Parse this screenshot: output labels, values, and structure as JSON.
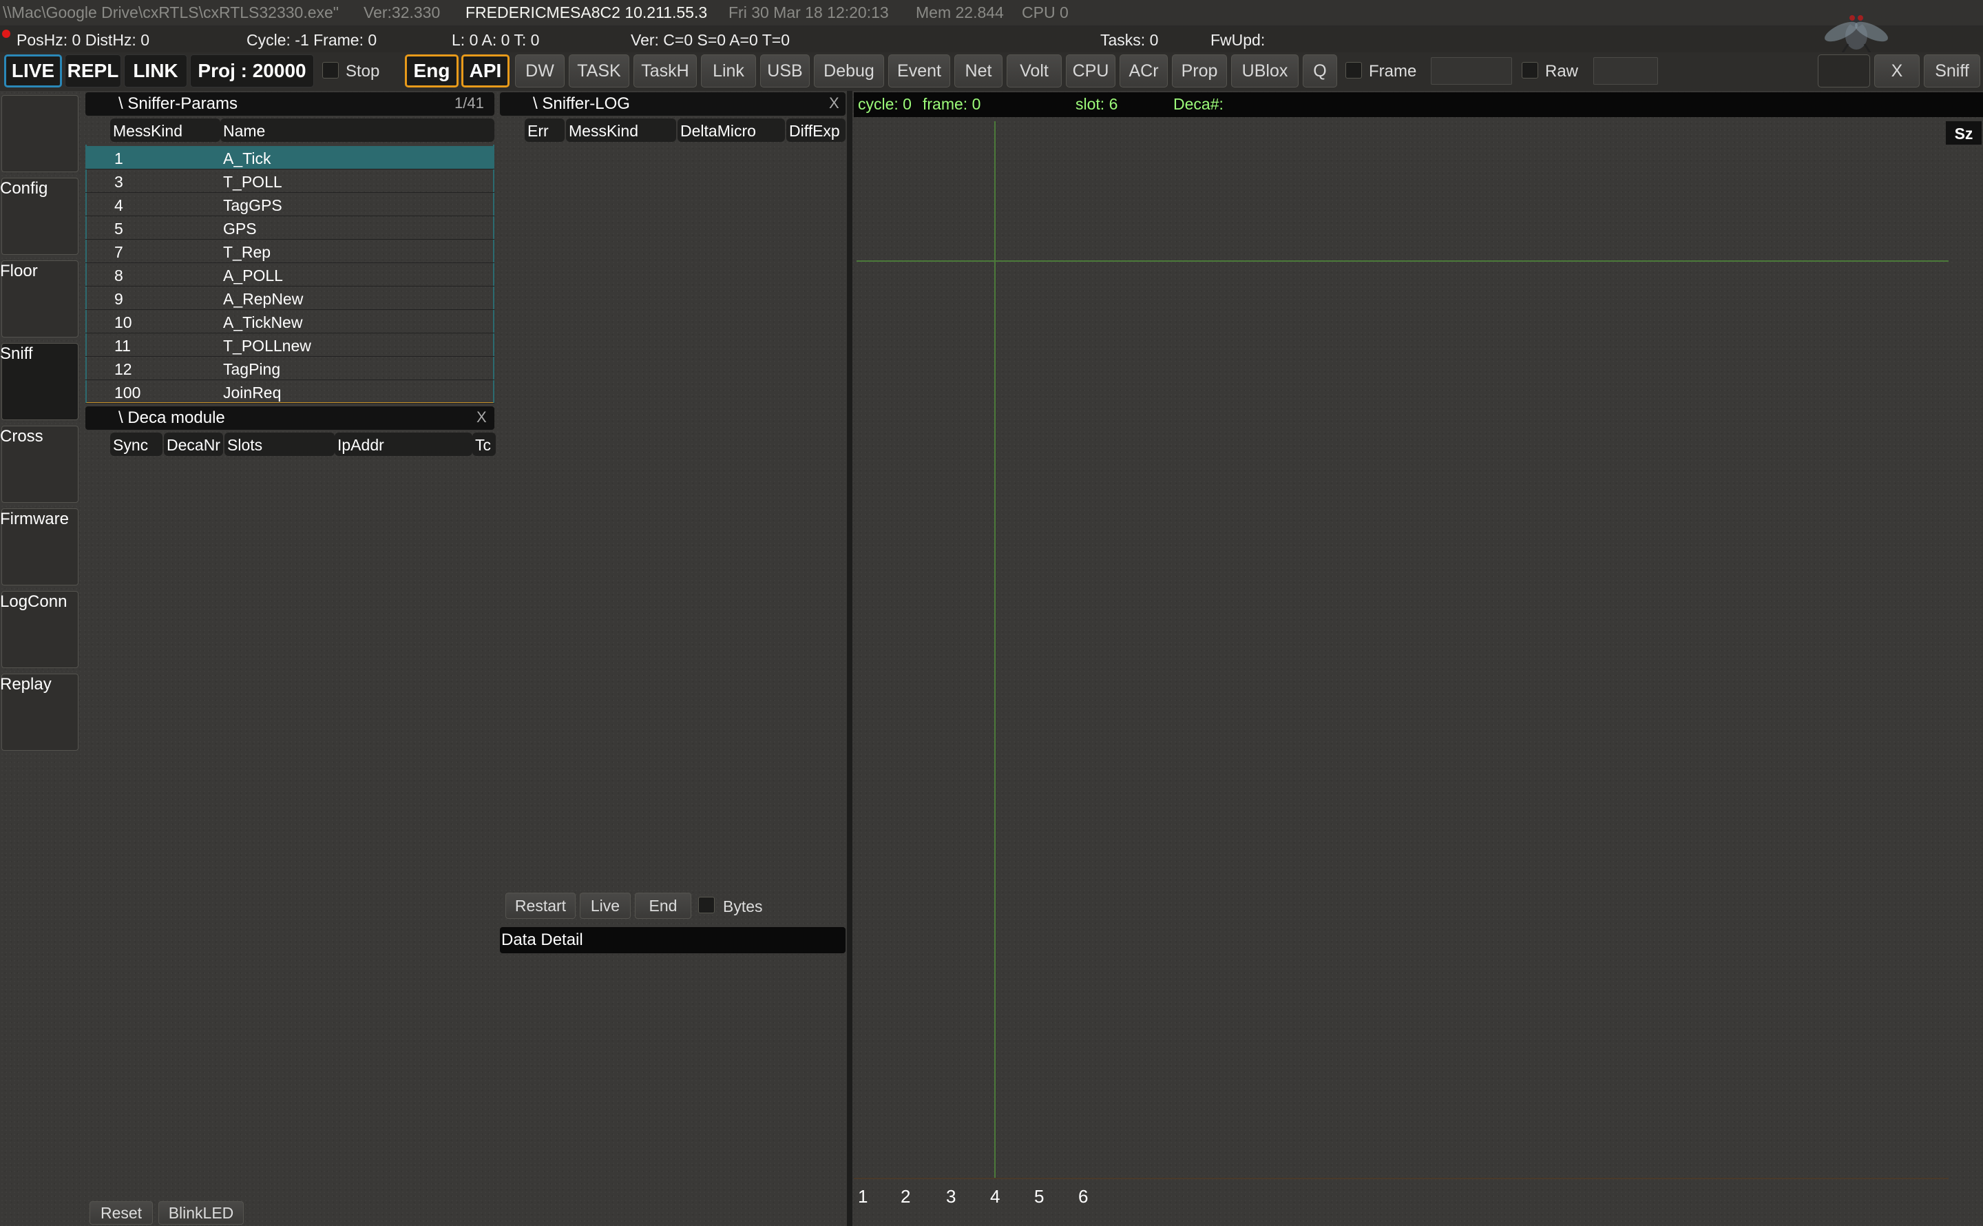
{
  "titlebar": {
    "path": "\\\\Mac\\Google Drive\\cxRTLS\\cxRTLS32330.exe\"",
    "version": "Ver:32.330",
    "host": "FREDERICMESA8C2 10.211.55.3",
    "datetime": "Fri 30 Mar 18 12:20:13",
    "mem": "Mem 22.844",
    "cpu": "CPU 0"
  },
  "status": {
    "poshz": "PosHz: 0 DistHz: 0",
    "cycle": "Cycle: -1  Frame: 0",
    "lat": "L: 0  A: 0  T: 0",
    "ver": "Ver: C=0 S=0 A=0 T=0",
    "tasks": "Tasks: 0",
    "fwupd": "FwUpd:"
  },
  "toolbar": {
    "live": "LIVE",
    "repl": "REPL",
    "link_mode": "LINK",
    "proj": "Proj : 20000",
    "stop": "Stop",
    "eng": "Eng",
    "api": "API",
    "buttons": [
      "DW",
      "TASK",
      "TaskH",
      "Link",
      "USB",
      "Debug",
      "Event",
      "Net",
      "Volt",
      "CPU",
      "ACr",
      "Prop",
      "UBlox",
      "Q"
    ],
    "frame": "Frame",
    "raw": "Raw",
    "close": "X",
    "sniff": "Sniff"
  },
  "nav": [
    "Config",
    "Floor",
    "Sniff",
    "Cross",
    "Firmware",
    "LogConn",
    "Replay"
  ],
  "sniffer_params": {
    "title": "\\ Sniffer-Params",
    "count": "1/41",
    "columns": [
      "MessKind",
      "Name"
    ],
    "rows": [
      [
        "1",
        "A_Tick"
      ],
      [
        "3",
        "T_POLL"
      ],
      [
        "4",
        "TagGPS"
      ],
      [
        "5",
        "GPS"
      ],
      [
        "7",
        "T_Rep"
      ],
      [
        "8",
        "A_POLL"
      ],
      [
        "9",
        "A_RepNew"
      ],
      [
        "10",
        "A_TickNew"
      ],
      [
        "11",
        "T_POLLnew"
      ],
      [
        "12",
        "TagPing"
      ],
      [
        "100",
        "JoinReq"
      ]
    ]
  },
  "deca_module": {
    "title": "\\ Deca module",
    "close": "X",
    "columns": [
      "Sync",
      "DecaNr",
      "Slots",
      "IpAddr",
      "Tc"
    ]
  },
  "sniffer_log": {
    "title": "\\ Sniffer-LOG",
    "close": "X",
    "columns": [
      "Err",
      "MessKind",
      "DeltaMicro",
      "DiffExp"
    ],
    "restart": "Restart",
    "live": "Live",
    "end": "End",
    "bytes": "Bytes",
    "detail": "Data Detail"
  },
  "graph": {
    "cycle": "cycle: 0",
    "frame": "frame: 0",
    "slot": "slot: 6",
    "deca": "Deca#:",
    "sz": "Sz",
    "axis": [
      "1",
      "2",
      "3",
      "4",
      "5",
      "6"
    ]
  },
  "bottom": {
    "reset": "Reset",
    "blink": "BlinkLED"
  }
}
